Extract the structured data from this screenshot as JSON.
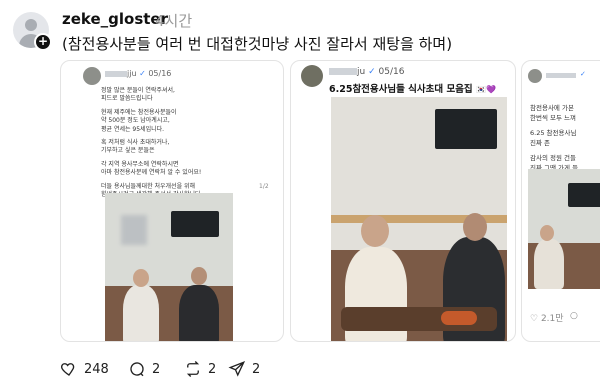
{
  "post": {
    "username": "zeke_gloster",
    "time": "4시간",
    "caption": "(참전용사분들 여러 번 대접한것마냥 사진 잘라서 재탕을 하며)"
  },
  "cards": [
    {
      "handle": "jju",
      "date": "05/16",
      "text": [
        "정말 많은 분들이 연락주셔서,",
        "피드로 말씀드립니다",
        "현재 제주에는 참전용사분들이",
        "약 500분 정도 남아계시고,",
        "평균 연세는 95세입니다.",
        "혹 저처럼 식사 초대하거나,",
        "기부하고 싶은 분들은",
        "각 지역 용사무소에 연락하시면",
        "아마 참전용사분께 연락처 알 수 있어요!",
        "더들 용사님들께대한 처우개선을 위해",
        "힘써주시려고 생각해 주셔서 감사합니다"
      ],
      "counter": "1/2"
    },
    {
      "handle": "ju",
      "date": "05/16",
      "title": "6.25참전용사님들 식사초대 모음집"
    },
    {
      "text": [
        "참전용사에 가본",
        "한번씩 모두 느껴",
        "6.25 참전용사님",
        "진짜 존",
        "감사의 정원 건들",
        "진짜 그땐 가게 들"
      ],
      "like_count": "2.1만"
    }
  ],
  "actions": {
    "likes": "248",
    "comments": "2",
    "reposts": "2",
    "shares": "2"
  }
}
